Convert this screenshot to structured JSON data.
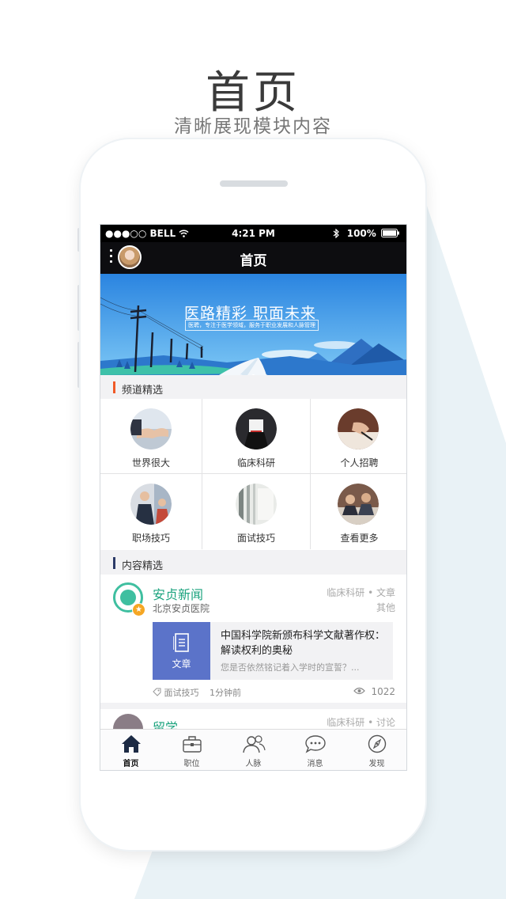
{
  "hero": {
    "title": "首页",
    "subtitle": "清晰展现模块内容"
  },
  "status_bar": {
    "carrier": "●●●○○ BELL",
    "time": "4:21 PM",
    "battery": "100%"
  },
  "nav": {
    "title": "首页"
  },
  "banner": {
    "headline": "医路精彩 职面未来",
    "subline": "医聘，专注于医学领域，服务于职业发展和人脉管理",
    "page_count": 3,
    "active_page": 1
  },
  "channels": {
    "section_title": "频道精选",
    "items": [
      {
        "label": "世界很大",
        "icon": "handshake-photo-icon"
      },
      {
        "label": "临床科研",
        "icon": "vote-photo-icon"
      },
      {
        "label": "个人招聘",
        "icon": "writing-photo-icon"
      },
      {
        "label": "职场技巧",
        "icon": "meeting-photo-icon"
      },
      {
        "label": "面试技巧",
        "icon": "office-photo-icon"
      },
      {
        "label": "查看更多",
        "icon": "team-photo-icon"
      }
    ]
  },
  "content": {
    "section_title": "内容精选",
    "card": {
      "source_name": "安贞新闻",
      "source_org": "北京安贞医院",
      "category": "临床科研",
      "type": "文章",
      "extra_tag": "其他",
      "thumb_label": "文章",
      "article_title": "中国科学院新颁布科学文献著作权：解读权利的奥秘",
      "article_desc": "您是否依然铭记着入学时的宣誓？...",
      "tag": "面试技巧",
      "time": "1分钟前",
      "views": "1022"
    },
    "peek": {
      "name": "留学",
      "tags": "临床科研 • 讨论"
    }
  },
  "tabs": [
    {
      "label": "首页",
      "icon": "home-icon",
      "active": true
    },
    {
      "label": "职位",
      "icon": "briefcase-icon",
      "active": false
    },
    {
      "label": "人脉",
      "icon": "people-icon",
      "active": false
    },
    {
      "label": "消息",
      "icon": "chat-bubble-icon",
      "active": false
    },
    {
      "label": "发现",
      "icon": "compass-icon",
      "active": false
    }
  ],
  "colors": {
    "accent_green": "#1ba37e",
    "article_thumb": "#5b73c9",
    "section_bar_orange": "#f05a28",
    "section_bar_navy": "#2b3a67",
    "banner_sky": "#2b8fe6"
  }
}
